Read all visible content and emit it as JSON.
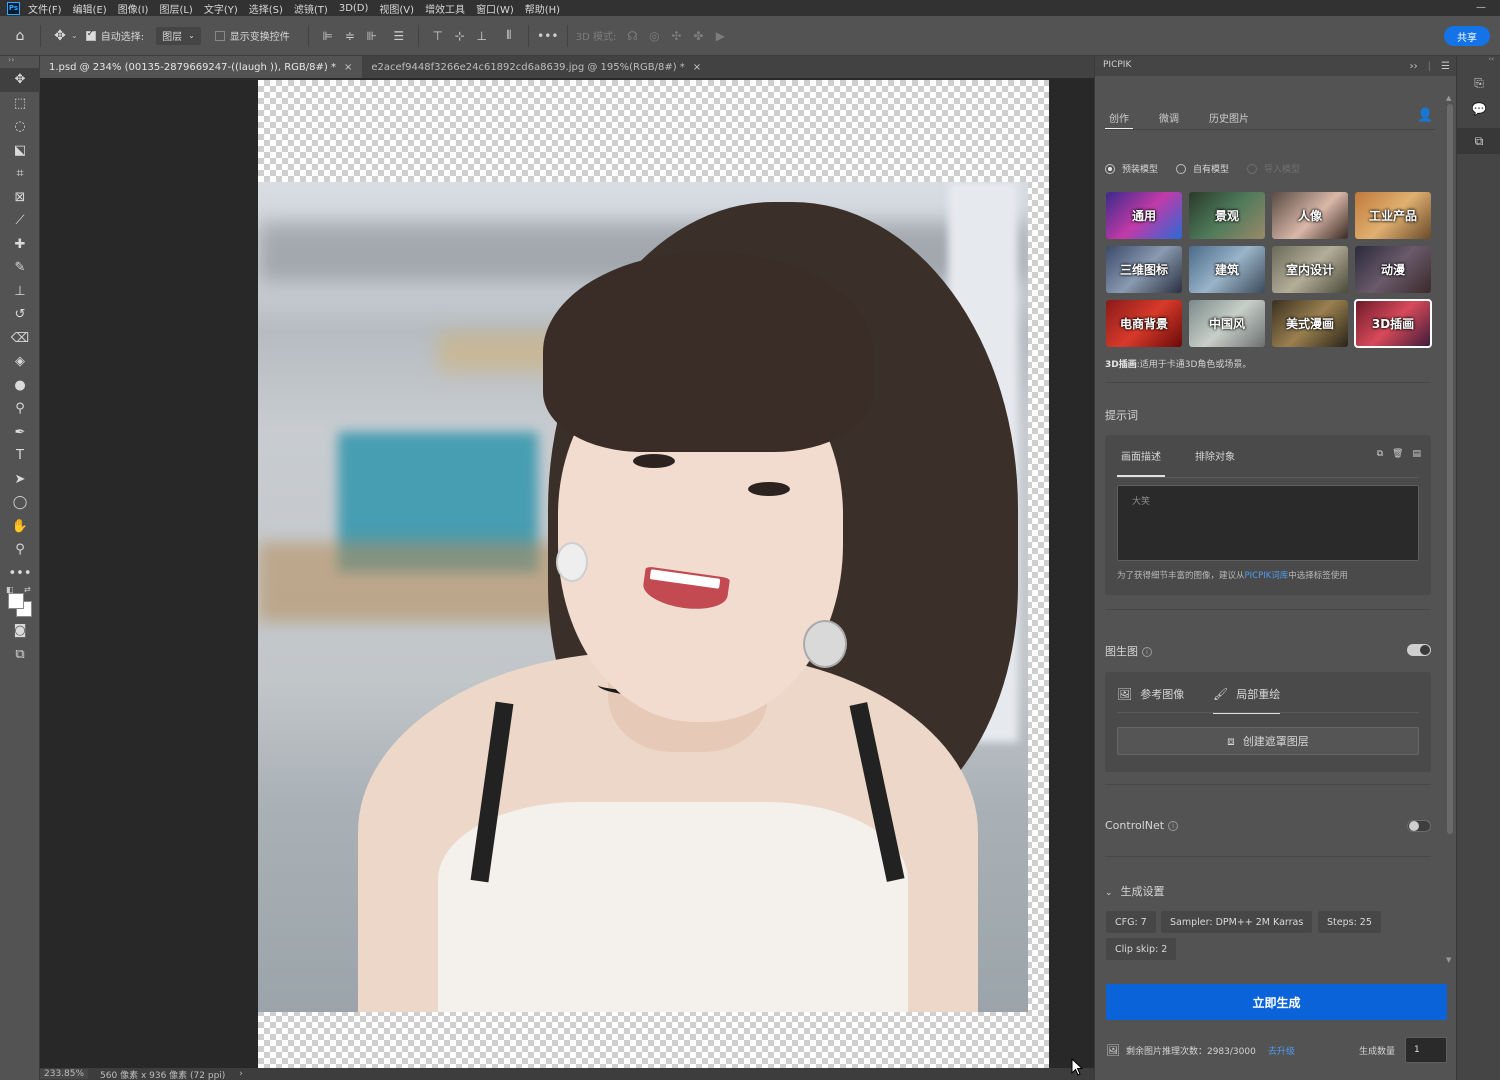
{
  "menu": [
    "文件(F)",
    "编辑(E)",
    "图像(I)",
    "图层(L)",
    "文字(Y)",
    "选择(S)",
    "滤镜(T)",
    "3D(D)",
    "视图(V)",
    "增效工具",
    "窗口(W)",
    "帮助(H)"
  ],
  "app_logo": "Ps",
  "options_bar": {
    "auto_select_label": "自动选择:",
    "layer_select": "图层",
    "show_transform_label": "显示变换控件",
    "mode_3d_label": "3D 模式:",
    "share_label": "共享"
  },
  "doc_tabs": [
    {
      "label": "1.psd @ 234% (00135-2879669247-((laugh )), RGB/8#) *",
      "close": "×"
    },
    {
      "label": "e2acef9448f3266e24c61892cd6a8639.jpg @ 195%(RGB/8#) *",
      "close": "×"
    }
  ],
  "status": {
    "zoom": "233.85%",
    "size": "560 像素 x 936 像素 (72 ppi)",
    "arrow": "›"
  },
  "panel": {
    "title": "PICPIK",
    "tabs": [
      "创作",
      "微调",
      "历史图片"
    ],
    "model_source": {
      "preset": "预装模型",
      "own": "自有模型",
      "import": "导入模型"
    },
    "models": [
      {
        "label": "通用"
      },
      {
        "label": "景观"
      },
      {
        "label": "人像"
      },
      {
        "label": "工业产品"
      },
      {
        "label": "三维图标"
      },
      {
        "label": "建筑"
      },
      {
        "label": "室内设计"
      },
      {
        "label": "动漫"
      },
      {
        "label": "电商背景"
      },
      {
        "label": "中国风"
      },
      {
        "label": "美式漫画"
      },
      {
        "label": "3D插画"
      }
    ],
    "selected_model_desc_name": "3D插画",
    "selected_model_desc_text": ":适用于卡通3D角色或场景。",
    "prompt": {
      "title": "提示词",
      "tabs": [
        "画面描述",
        "排除对象"
      ],
      "value": "大笑",
      "hint_before": "为了获得细节丰富的图像，建议从",
      "hint_link": "PICPIK词库",
      "hint_after": "中选择标签使用"
    },
    "img2img": {
      "title": "图生图",
      "tabs": [
        "参考图像",
        "局部重绘"
      ],
      "mask_button": "创建遮罩图层",
      "enabled": true
    },
    "controlnet": {
      "title": "ControlNet",
      "enabled": false
    },
    "gen_settings": {
      "title": "生成设置",
      "chips": [
        "CFG: 7",
        "Sampler: DPM++ 2M Karras",
        "Steps: 25",
        "Clip skip: 2"
      ]
    },
    "generate_label": "立即生成",
    "remaining_label": "剩余图片推理次数：2983/3000",
    "upgrade_link": "去升级",
    "quantity_label": "生成数量",
    "quantity_value": "1"
  },
  "colors": {
    "accent_blue": "#1473e6",
    "generate_blue": "#0a63d9",
    "link_blue": "#4f9cf0"
  }
}
